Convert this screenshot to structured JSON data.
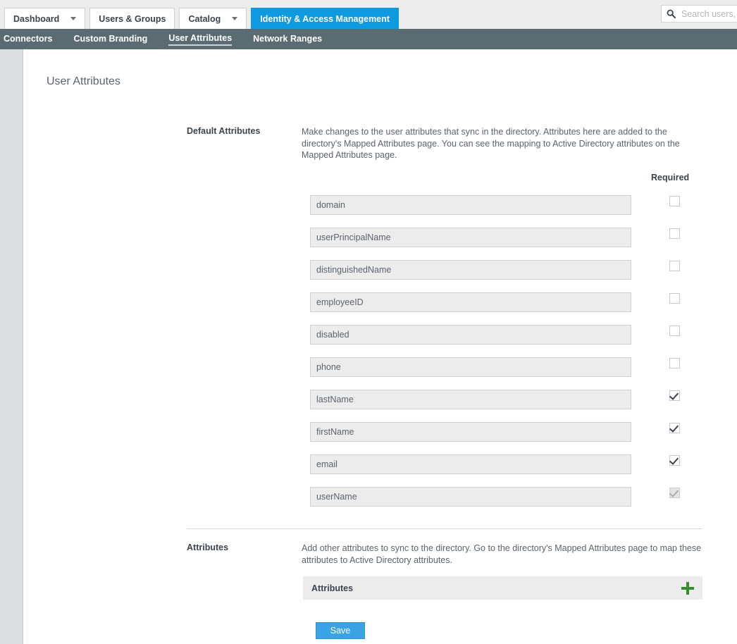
{
  "header": {
    "tabs": [
      {
        "label": "Dashboard",
        "caret": true,
        "active": false
      },
      {
        "label": "Users & Groups",
        "caret": false,
        "active": false
      },
      {
        "label": "Catalog",
        "caret": true,
        "active": false
      },
      {
        "label": "Identity & Access Management",
        "caret": false,
        "active": true
      }
    ],
    "search": {
      "placeholder": "Search users, ",
      "value": "",
      "icon": "search-icon"
    }
  },
  "subnav": {
    "items": [
      {
        "label": "Connectors",
        "active": false
      },
      {
        "label": "Custom Branding",
        "active": false
      },
      {
        "label": "User Attributes",
        "active": true
      },
      {
        "label": "Network Ranges",
        "active": false
      }
    ]
  },
  "page": {
    "title": "User Attributes"
  },
  "default_attributes": {
    "label": "Default Attributes",
    "description": "Make changes to the user attributes that sync in the directory. Attributes here are added to the directory's Mapped Attributes page.  You can see the mapping to Active Directory attributes on the Mapped Attributes page.",
    "required_column_header": "Required",
    "rows": [
      {
        "name": "domain",
        "required": false,
        "disabled": false
      },
      {
        "name": "userPrincipalName",
        "required": false,
        "disabled": false
      },
      {
        "name": "distinguishedName",
        "required": false,
        "disabled": false
      },
      {
        "name": "employeeID",
        "required": false,
        "disabled": false
      },
      {
        "name": "disabled",
        "required": false,
        "disabled": false
      },
      {
        "name": "phone",
        "required": false,
        "disabled": false
      },
      {
        "name": "lastName",
        "required": true,
        "disabled": false
      },
      {
        "name": "firstName",
        "required": true,
        "disabled": false
      },
      {
        "name": "email",
        "required": true,
        "disabled": false
      },
      {
        "name": "userName",
        "required": true,
        "disabled": true
      }
    ]
  },
  "attributes_section": {
    "label": "Attributes",
    "description": "Add other attributes to sync to the directory. Go to the directory's Mapped Attributes page to map these attributes to Active Directory attributes.",
    "panel_label": "Attributes",
    "add_icon": "plus-icon"
  },
  "footer": {
    "save_label": "Save"
  },
  "colors": {
    "accent_blue": "#0e9ae0",
    "subnav_slate": "#5a6b72",
    "save_blue": "#3aa3e3",
    "plus_green": "#3a8a30",
    "field_gray": "#ececec",
    "rail_gray": "#dcdddf"
  }
}
